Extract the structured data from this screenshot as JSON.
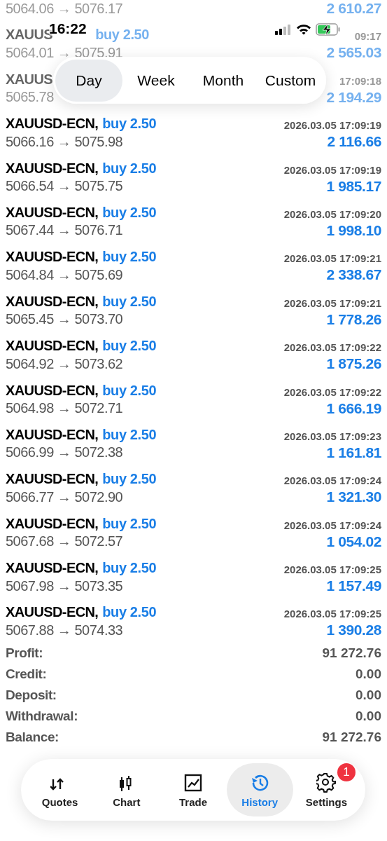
{
  "status_bar": {
    "time": "16:22"
  },
  "period_tabs": [
    {
      "label": "Day",
      "selected": true
    },
    {
      "label": "Week",
      "selected": false
    },
    {
      "label": "Month",
      "selected": false
    },
    {
      "label": "Custom",
      "selected": false
    }
  ],
  "deals": [
    {
      "obscured": true,
      "prices": "5064.06 → 5076.17",
      "profit": "2 610.27"
    },
    {
      "obscured": true,
      "symbol": "XAUUS",
      "side_volume": "buy 2.50",
      "time": "09:17",
      "prices": "5064.01 → 5075.91",
      "profit": "2 565.03"
    },
    {
      "obscured": true,
      "symbol": "XAUUS",
      "time": "17:09:18",
      "prices": "5065.78",
      "profit": "2 194.29"
    },
    {
      "obscured": false,
      "symbol": "XAUUSD-ECN,",
      "side_volume": "buy 2.50",
      "time": "2026.03.05 17:09:19",
      "prices": "5066.16 → 5075.98",
      "profit": "2 116.66"
    },
    {
      "obscured": false,
      "symbol": "XAUUSD-ECN,",
      "side_volume": "buy 2.50",
      "time": "2026.03.05 17:09:19",
      "prices": "5066.54 → 5075.75",
      "profit": "1 985.17"
    },
    {
      "obscured": false,
      "symbol": "XAUUSD-ECN,",
      "side_volume": "buy 2.50",
      "time": "2026.03.05 17:09:20",
      "prices": "5067.44 → 5076.71",
      "profit": "1 998.10"
    },
    {
      "obscured": false,
      "symbol": "XAUUSD-ECN,",
      "side_volume": "buy 2.50",
      "time": "2026.03.05 17:09:21",
      "prices": "5064.84 → 5075.69",
      "profit": "2 338.67"
    },
    {
      "obscured": false,
      "symbol": "XAUUSD-ECN,",
      "side_volume": "buy 2.50",
      "time": "2026.03.05 17:09:21",
      "prices": "5065.45 → 5073.70",
      "profit": "1 778.26"
    },
    {
      "obscured": false,
      "symbol": "XAUUSD-ECN,",
      "side_volume": "buy 2.50",
      "time": "2026.03.05 17:09:22",
      "prices": "5064.92 → 5073.62",
      "profit": "1 875.26"
    },
    {
      "obscured": false,
      "symbol": "XAUUSD-ECN,",
      "side_volume": "buy 2.50",
      "time": "2026.03.05 17:09:22",
      "prices": "5064.98 → 5072.71",
      "profit": "1 666.19"
    },
    {
      "obscured": false,
      "symbol": "XAUUSD-ECN,",
      "side_volume": "buy 2.50",
      "time": "2026.03.05 17:09:23",
      "prices": "5066.99 → 5072.38",
      "profit": "1 161.81"
    },
    {
      "obscured": false,
      "symbol": "XAUUSD-ECN,",
      "side_volume": "buy 2.50",
      "time": "2026.03.05 17:09:24",
      "prices": "5066.77 → 5072.90",
      "profit": "1 321.30"
    },
    {
      "obscured": false,
      "symbol": "XAUUSD-ECN,",
      "side_volume": "buy 2.50",
      "time": "2026.03.05 17:09:24",
      "prices": "5067.68 → 5072.57",
      "profit": "1 054.02"
    },
    {
      "obscured": false,
      "symbol": "XAUUSD-ECN,",
      "side_volume": "buy 2.50",
      "time": "2026.03.05 17:09:25",
      "prices": "5067.98 → 5073.35",
      "profit": "1 157.49"
    },
    {
      "obscured": false,
      "symbol": "XAUUSD-ECN,",
      "side_volume": "buy 2.50",
      "time": "2026.03.05 17:09:25",
      "prices": "5067.88 → 5074.33",
      "profit": "1 390.28"
    }
  ],
  "summary": [
    {
      "label": "Profit:",
      "value": "91 272.76"
    },
    {
      "label": "Credit:",
      "value": "0.00"
    },
    {
      "label": "Deposit:",
      "value": "0.00"
    },
    {
      "label": "Withdrawal:",
      "value": "0.00"
    },
    {
      "label": "Balance:",
      "value": "91 272.76"
    }
  ],
  "nav": [
    {
      "kind": "quotes",
      "label": "Quotes",
      "selected": false
    },
    {
      "kind": "chart",
      "label": "Chart",
      "selected": false
    },
    {
      "kind": "trade",
      "label": "Trade",
      "selected": false
    },
    {
      "kind": "history",
      "label": "History",
      "selected": true
    },
    {
      "kind": "settings",
      "label": "Settings",
      "selected": false,
      "badge": "1"
    }
  ]
}
